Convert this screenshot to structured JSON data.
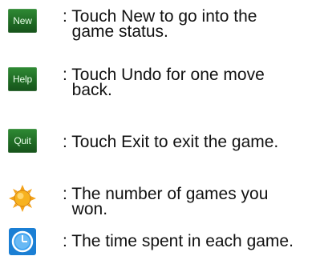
{
  "rows": [
    {
      "button_label": "New",
      "description": ": Touch New to go into the\n  game status."
    },
    {
      "button_label": "Help",
      "description": ": Touch Undo for one move\n  back."
    },
    {
      "button_label": "Quit",
      "description": ": Touch Exit to exit the game."
    },
    {
      "icon": "sun-icon",
      "description": ": The number of games you\n  won."
    },
    {
      "icon": "clock-icon",
      "description": ": The time spent in each game."
    }
  ],
  "colors": {
    "button_green": "#1f6b24",
    "sun_orange": "#f3a21a",
    "clock_blue": "#1d7fd6"
  }
}
